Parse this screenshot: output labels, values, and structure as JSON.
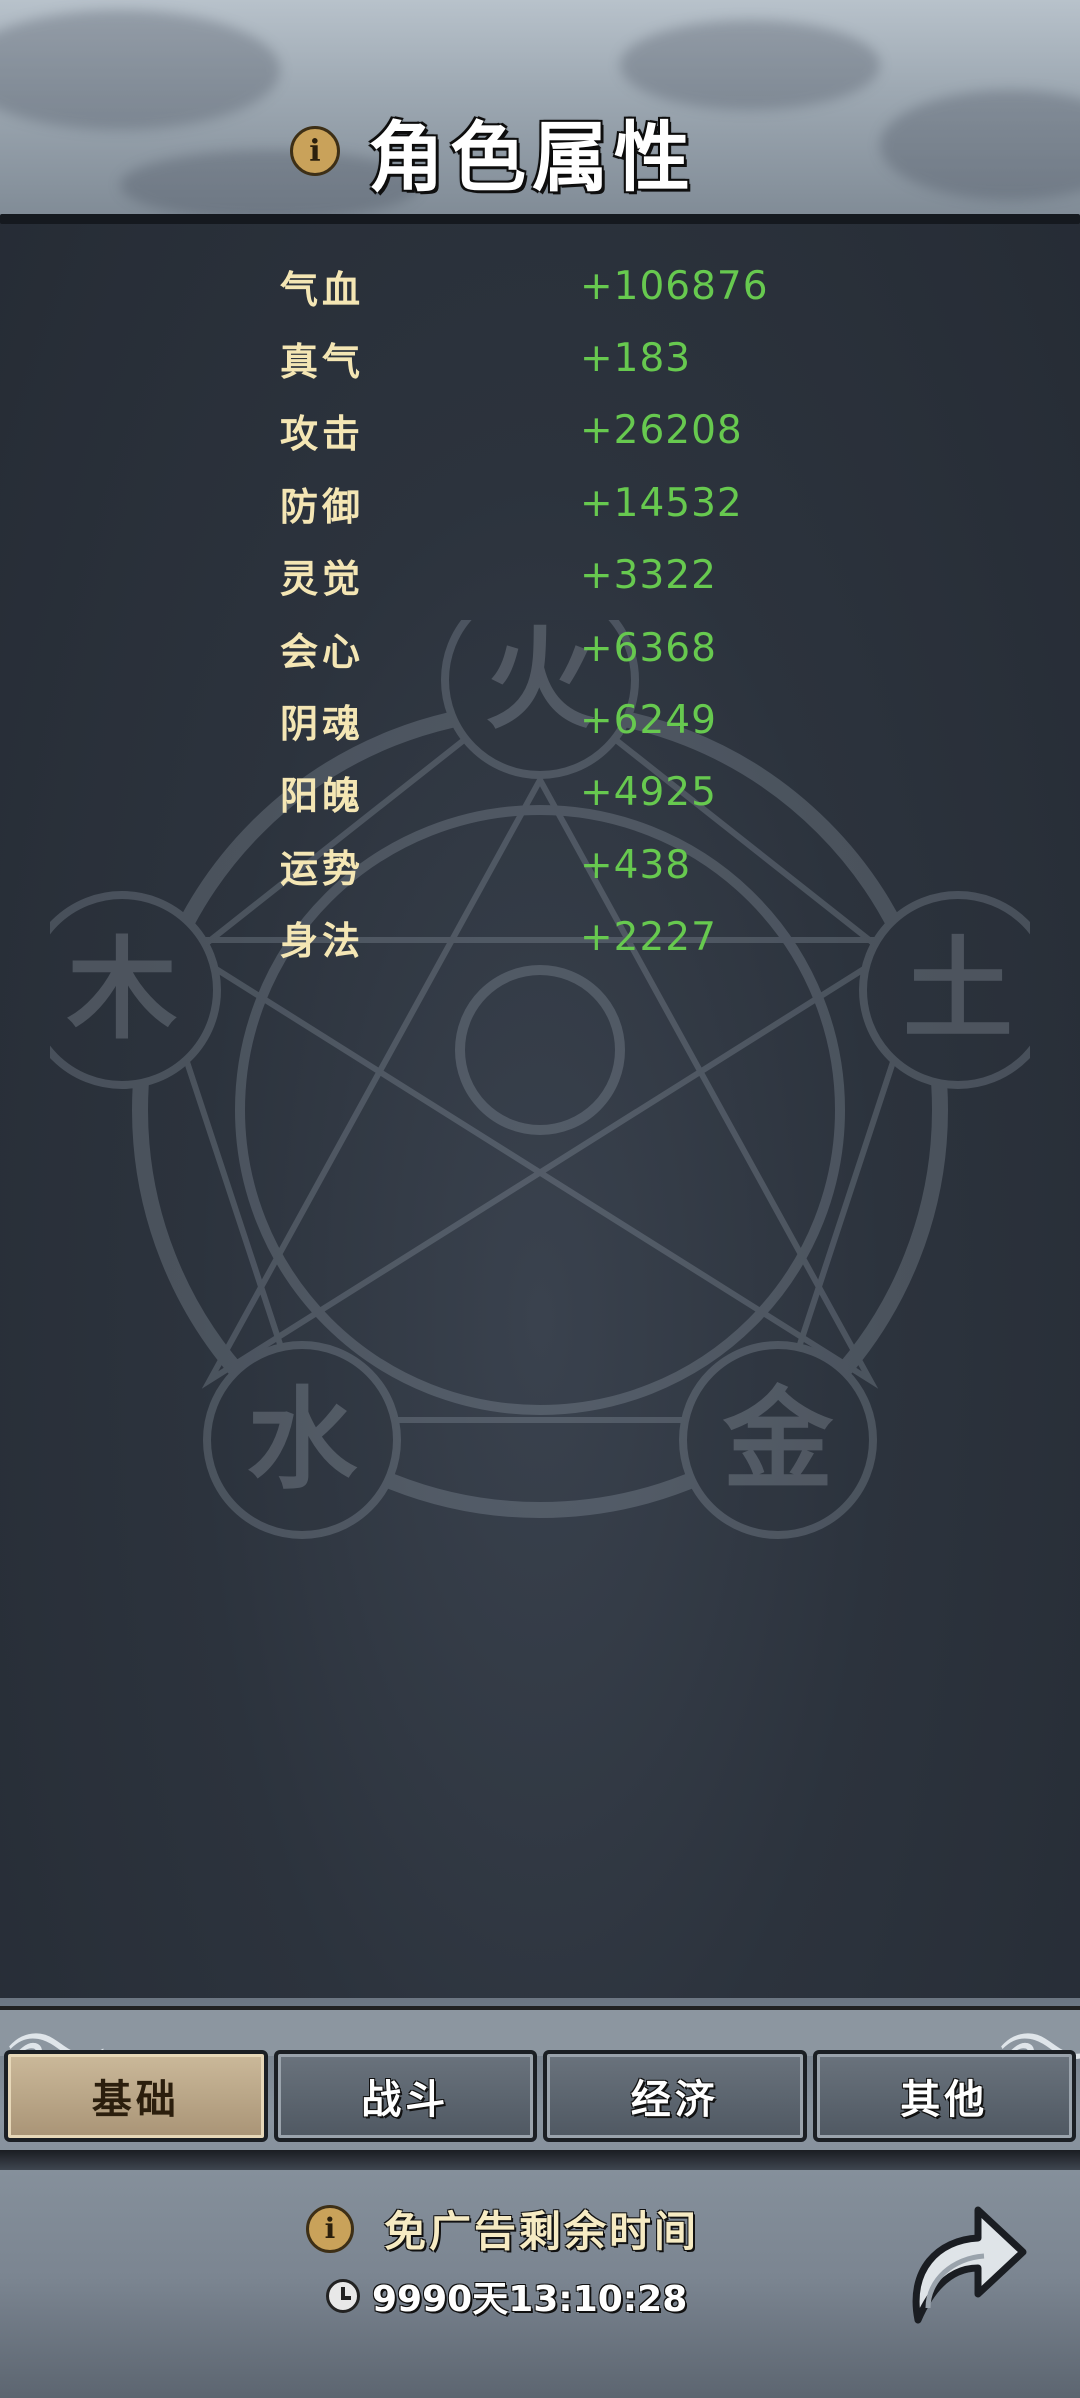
{
  "header": {
    "title": "角色属性",
    "info_icon": "info-icon"
  },
  "stats": [
    {
      "name": "气血",
      "value": "+106876"
    },
    {
      "name": "真气",
      "value": "+183"
    },
    {
      "name": "攻击",
      "value": "+26208"
    },
    {
      "name": "防御",
      "value": "+14532"
    },
    {
      "name": "灵觉",
      "value": "+3322"
    },
    {
      "name": "会心",
      "value": "+6368"
    },
    {
      "name": "阴魂",
      "value": "+6249"
    },
    {
      "name": "阳魄",
      "value": "+4925"
    },
    {
      "name": "运势",
      "value": "+438"
    },
    {
      "name": "身法",
      "value": "+2227"
    }
  ],
  "wuxing": {
    "fire": "火",
    "earth": "土",
    "metal": "金",
    "water": "水",
    "wood": "木"
  },
  "tabs": [
    {
      "label": "基础",
      "active": true
    },
    {
      "label": "战斗",
      "active": false
    },
    {
      "label": "经济",
      "active": false
    },
    {
      "label": "其他",
      "active": false
    }
  ],
  "ad": {
    "label": "免广告剩余时间",
    "timer": "9990天13:10:28"
  },
  "colors": {
    "stat_name": "#f4e6b4",
    "stat_value": "#67c94f",
    "active_tab": "#cbb99a"
  }
}
